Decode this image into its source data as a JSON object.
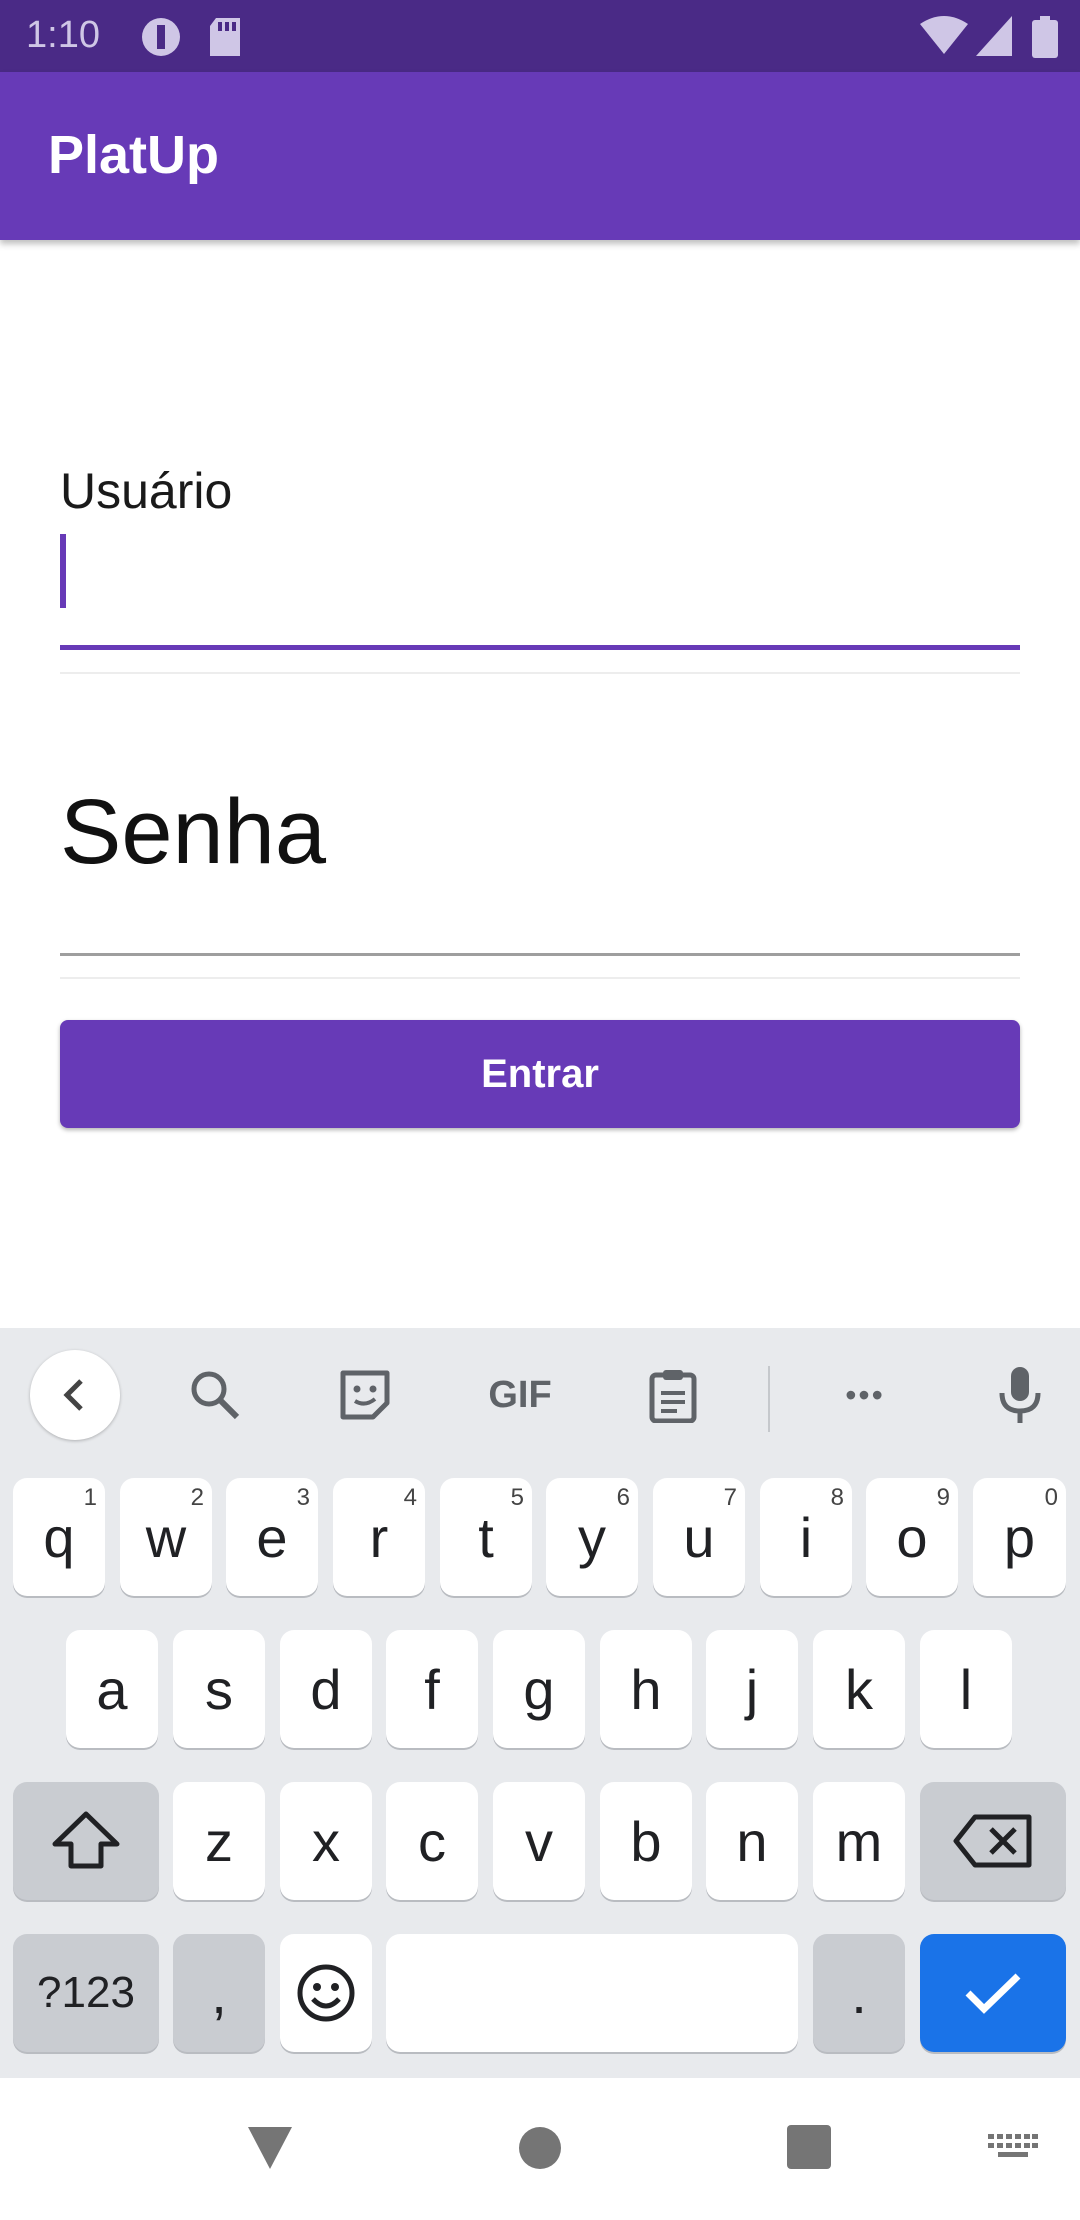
{
  "status_bar": {
    "time": "1:10"
  },
  "app_bar": {
    "title": "PlatUp"
  },
  "form": {
    "username_label": "Usuário",
    "username_value": "",
    "password_placeholder": "Senha",
    "submit_label": "Entrar"
  },
  "keyboard": {
    "toolbar_icons": [
      "back-chevron-icon",
      "search-icon",
      "sticker-icon",
      "gif-icon",
      "clipboard-icon",
      "more-icon",
      "mic-icon"
    ],
    "gif_label": "GIF",
    "more_label": "•••",
    "row1": [
      {
        "k": "q",
        "h": "1"
      },
      {
        "k": "w",
        "h": "2"
      },
      {
        "k": "e",
        "h": "3"
      },
      {
        "k": "r",
        "h": "4"
      },
      {
        "k": "t",
        "h": "5"
      },
      {
        "k": "y",
        "h": "6"
      },
      {
        "k": "u",
        "h": "7"
      },
      {
        "k": "i",
        "h": "8"
      },
      {
        "k": "o",
        "h": "9"
      },
      {
        "k": "p",
        "h": "0"
      }
    ],
    "row2": [
      "a",
      "s",
      "d",
      "f",
      "g",
      "h",
      "j",
      "k",
      "l"
    ],
    "row3": [
      "z",
      "x",
      "c",
      "v",
      "b",
      "n",
      "m"
    ],
    "symbols_label": "?123",
    "comma_label": ",",
    "period_label": ".",
    "accent_color": "#1a73e8"
  },
  "nav_bar": {
    "icons": [
      "back-icon",
      "home-icon",
      "recents-icon",
      "keyboard-switch-icon"
    ]
  },
  "colors": {
    "primary": "#673ab7",
    "status_bar": "#4a2a86"
  }
}
